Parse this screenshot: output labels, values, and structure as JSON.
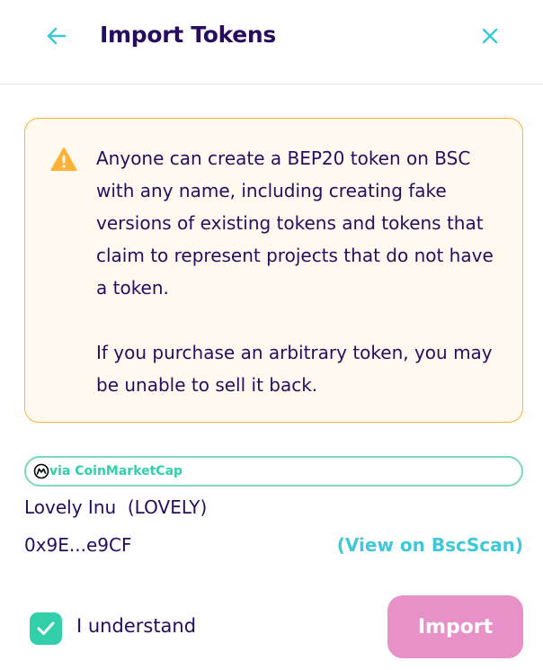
{
  "header": {
    "title": "Import Tokens",
    "back_icon": "arrow-left-icon",
    "close_icon": "close-icon"
  },
  "warning": {
    "icon": "warning-triangle-icon",
    "paragraph1": "Anyone can create a BEP20 token on BSC with any name, including creating fake versions of existing tokens and tokens that claim to represent projects that do not have a token.",
    "paragraph2": "If you purchase an arbitrary token, you may be unable to sell it back."
  },
  "source": {
    "icon": "coinmarketcap-icon",
    "label": "via CoinMarketCap"
  },
  "token": {
    "name_symbol": "Lovely Inu  (LOVELY)",
    "address": "0x9E...e9CF",
    "view_link": "(View on BscScan)"
  },
  "footer": {
    "checkbox_checked": true,
    "understand_label": "I understand",
    "import_label": "Import"
  },
  "colors": {
    "primary_text": "#280d5f",
    "accent_teal": "#31d0aa",
    "link_cyan": "#40c8d8",
    "warning_border": "#ffb237",
    "warning_bg": "#fff9ef",
    "import_button": "#e890c8"
  }
}
